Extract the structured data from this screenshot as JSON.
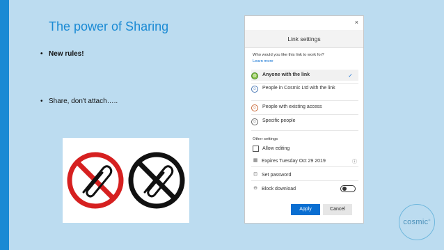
{
  "slide": {
    "title": "The power of Sharing",
    "bullets": [
      {
        "marker": "•",
        "text": "New rules!"
      },
      {
        "marker": "•",
        "text": "Share, don't attach….."
      }
    ],
    "accent_color": "#1a8ad4",
    "background_color": "#bcdcf0"
  },
  "dialog": {
    "close_glyph": "×",
    "header": "Link settings",
    "question": "Who would you like this link to work for?",
    "learn_more": "Learn more",
    "options": [
      {
        "icon": "globe-icon",
        "glyph": "◍",
        "label": "Anyone with the link",
        "selected": true
      },
      {
        "icon": "people-icon",
        "glyph": "☺",
        "label": "People in Cosmic Ltd with the link",
        "selected": false
      },
      {
        "icon": "people-access-icon",
        "glyph": "☺",
        "label": "People with existing access",
        "selected": false
      },
      {
        "icon": "person-icon",
        "glyph": "☺",
        "label": "Specific people",
        "selected": false
      }
    ],
    "check_glyph": "✓",
    "other_settings": "Other settings",
    "allow_editing": {
      "label": "Allow editing",
      "checked": false
    },
    "expires": {
      "label": "Expires Tuesday Oct 29 2019",
      "icon": "calendar-icon",
      "glyph": "▦",
      "info_glyph": "ⓘ"
    },
    "set_password": {
      "label": "Set password",
      "icon": "lock-icon",
      "glyph": "⊡"
    },
    "block_download": {
      "label": "Block download",
      "icon": "block-icon",
      "glyph": "⊖",
      "on": false
    },
    "apply_label": "Apply",
    "cancel_label": "Cancel",
    "primary_color": "#0a6ed1"
  },
  "logo": {
    "text": "cosmic",
    "mark": "®"
  }
}
